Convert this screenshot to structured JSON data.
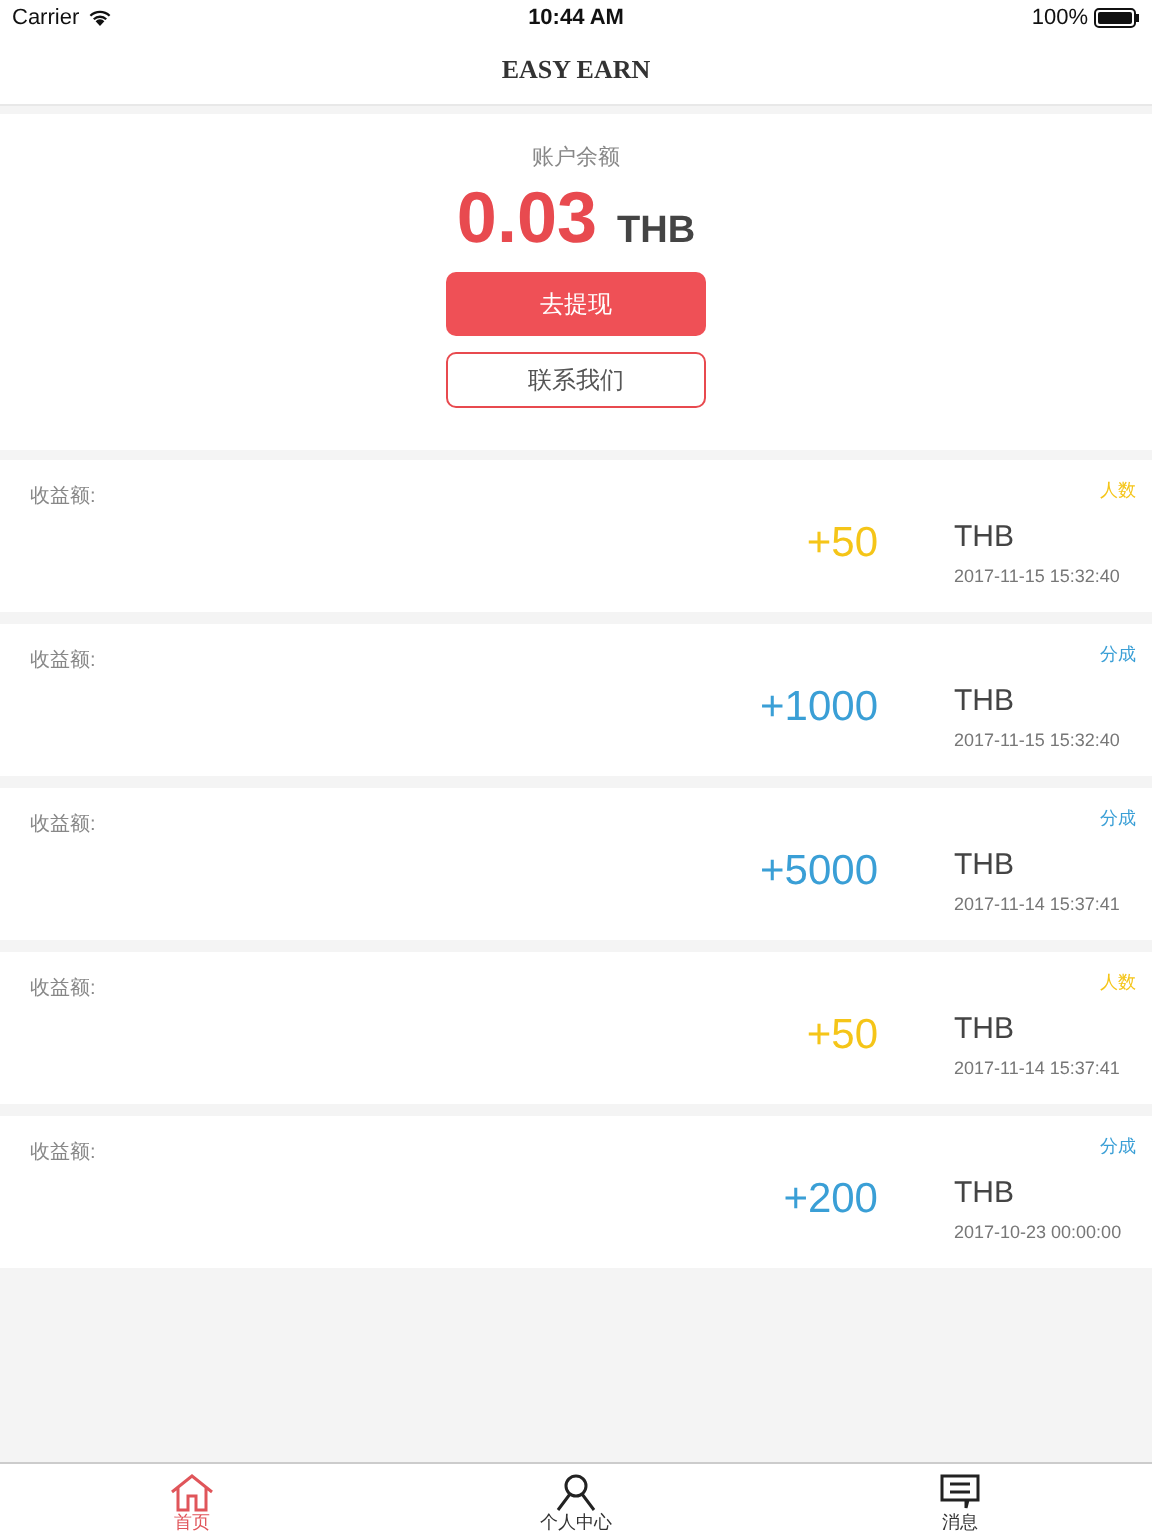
{
  "status_bar": {
    "carrier": "Carrier",
    "time": "10:44 AM",
    "battery": "100%"
  },
  "nav": {
    "title": "EASY EARN"
  },
  "balance": {
    "label": "账户余额",
    "amount": "0.03",
    "currency": "THB",
    "withdraw_button": "去提现",
    "contact_button": "联系我们"
  },
  "records": [
    {
      "label": "收益额:",
      "tag": "人数",
      "color": "#f5c518",
      "amount": "+50",
      "currency": "THB",
      "time": "2017-11-15 15:32:40"
    },
    {
      "label": "收益额:",
      "tag": "分成",
      "color": "#3a9fd6",
      "amount": "+1000",
      "currency": "THB",
      "time": "2017-11-15 15:32:40"
    },
    {
      "label": "收益额:",
      "tag": "分成",
      "color": "#3a9fd6",
      "amount": "+5000",
      "currency": "THB",
      "time": "2017-11-14 15:37:41"
    },
    {
      "label": "收益额:",
      "tag": "人数",
      "color": "#f5c518",
      "amount": "+50",
      "currency": "THB",
      "time": "2017-11-14 15:37:41"
    },
    {
      "label": "收益额:",
      "tag": "分成",
      "color": "#3a9fd6",
      "amount": "+200",
      "currency": "THB",
      "time": "2017-10-23 00:00:00"
    }
  ],
  "tab_bar": [
    {
      "label": "首页",
      "kind": "home",
      "selected": true
    },
    {
      "label": "个人中心",
      "kind": "person",
      "selected": false
    },
    {
      "label": "消息",
      "kind": "message",
      "selected": false
    }
  ]
}
